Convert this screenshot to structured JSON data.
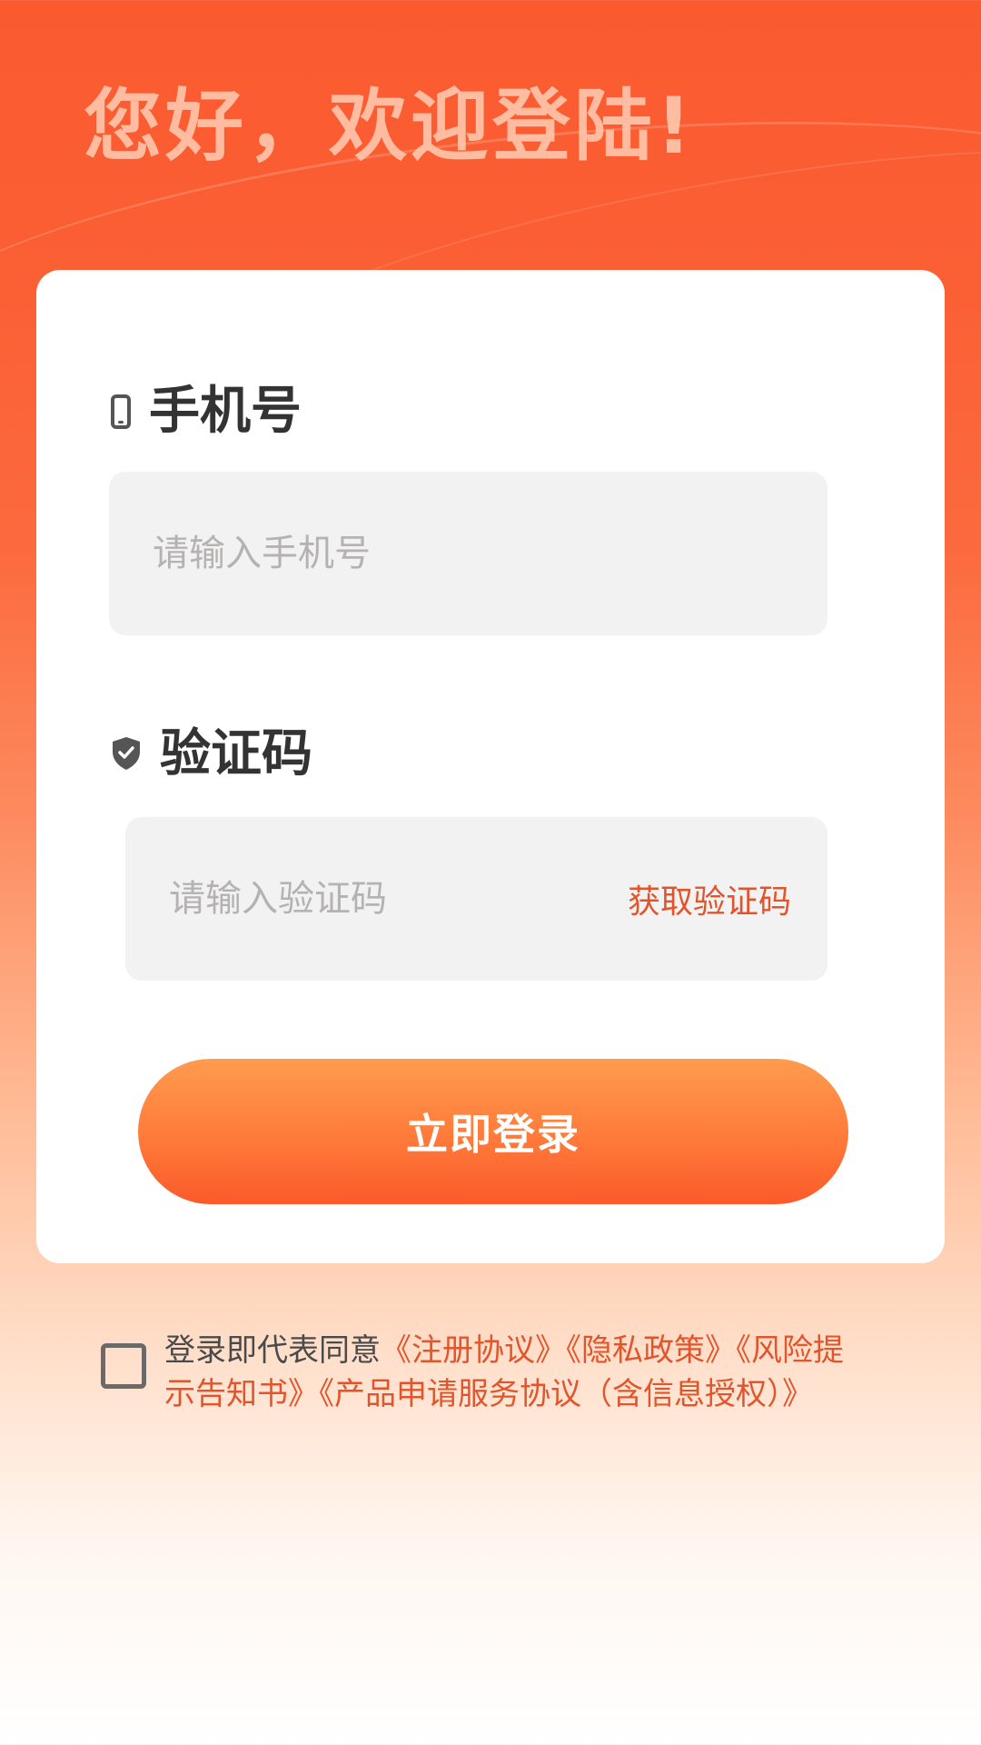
{
  "header": {
    "greeting": "您好，欢迎登陆!"
  },
  "form": {
    "phone": {
      "label": "手机号",
      "placeholder": "请输入手机号",
      "value": ""
    },
    "code": {
      "label": "验证码",
      "placeholder": "请输入验证码",
      "value": "",
      "get_code_label": "获取验证码"
    },
    "login_label": "立即登录"
  },
  "agreement": {
    "checked": false,
    "prefix": "登录即代表同意",
    "links": [
      "《注册协议》",
      "《隐私政策》",
      "《风险提示告知书》",
      "《产品申请服务协议（含信息授权）》"
    ]
  },
  "colors": {
    "brand": "#fb5a2f",
    "link": "#e2552c"
  },
  "icons": {
    "phone": "phone-icon",
    "shield": "shield-check-icon"
  }
}
